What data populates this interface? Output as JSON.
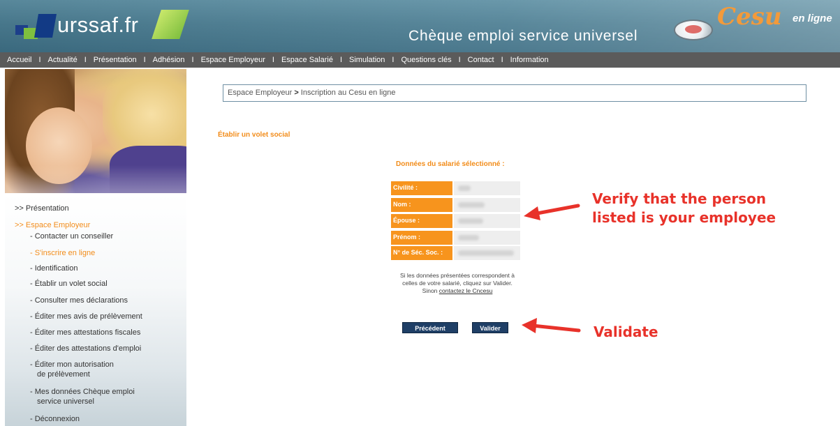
{
  "header": {
    "logo_text": "urssaf.fr",
    "tagline": "Chèque emploi service universel",
    "brand_word": "Cesu",
    "brand_sub": "en ligne"
  },
  "nav": {
    "items": [
      "Accueil",
      "Actualité",
      "Présentation",
      "Adhésion",
      "Espace Employeur",
      "Espace Salarié",
      "Simulation",
      "Questions clés",
      "Contact",
      "Information"
    ]
  },
  "sidebar": {
    "presentation": ">> Présentation",
    "espace_employeur": ">> Espace Employeur",
    "items": [
      "- Contacter un conseiller",
      "- S'inscrire en ligne",
      "- Identification",
      "- Établir un volet social",
      "- Consulter mes déclarations",
      "- Éditer mes avis de prélèvement",
      "- Éditer mes attestations fiscales",
      "- Éditer des attestations d'emploi",
      "- Éditer mon autorisation",
      "de prélèvement",
      "- Mes données Chèque emploi",
      "service universel",
      "- Déconnexion"
    ]
  },
  "breadcrumb": {
    "parent": "Espace Employeur",
    "separator": ">",
    "current": "Inscription au Cesu en ligne"
  },
  "main": {
    "section_title": "Établir un volet social",
    "data_title": "Données du salarié sélectionné :",
    "fields": [
      "Civilité :",
      "Nom :",
      "Épouse :",
      "Prénom :",
      "N° de Séc. Soc. :"
    ],
    "confirm_line1": "Si les données présentées correspondent à",
    "confirm_line2": "celles de votre salarié, cliquez sur Valider.",
    "confirm_line3": "Sinon",
    "confirm_link": "contactez le Cncesu",
    "btn_previous": "Précédent",
    "btn_validate": "Valider"
  },
  "annotations": {
    "verify_line1": "Verify that the person",
    "verify_line2": "listed is your employee",
    "validate": "Validate",
    "color": "#e8322a"
  },
  "colors": {
    "accent_orange": "#f7941d",
    "nav_bg": "#5b5b5b",
    "button_bg": "#1f3f66",
    "header_bg": "#4b7d92"
  }
}
